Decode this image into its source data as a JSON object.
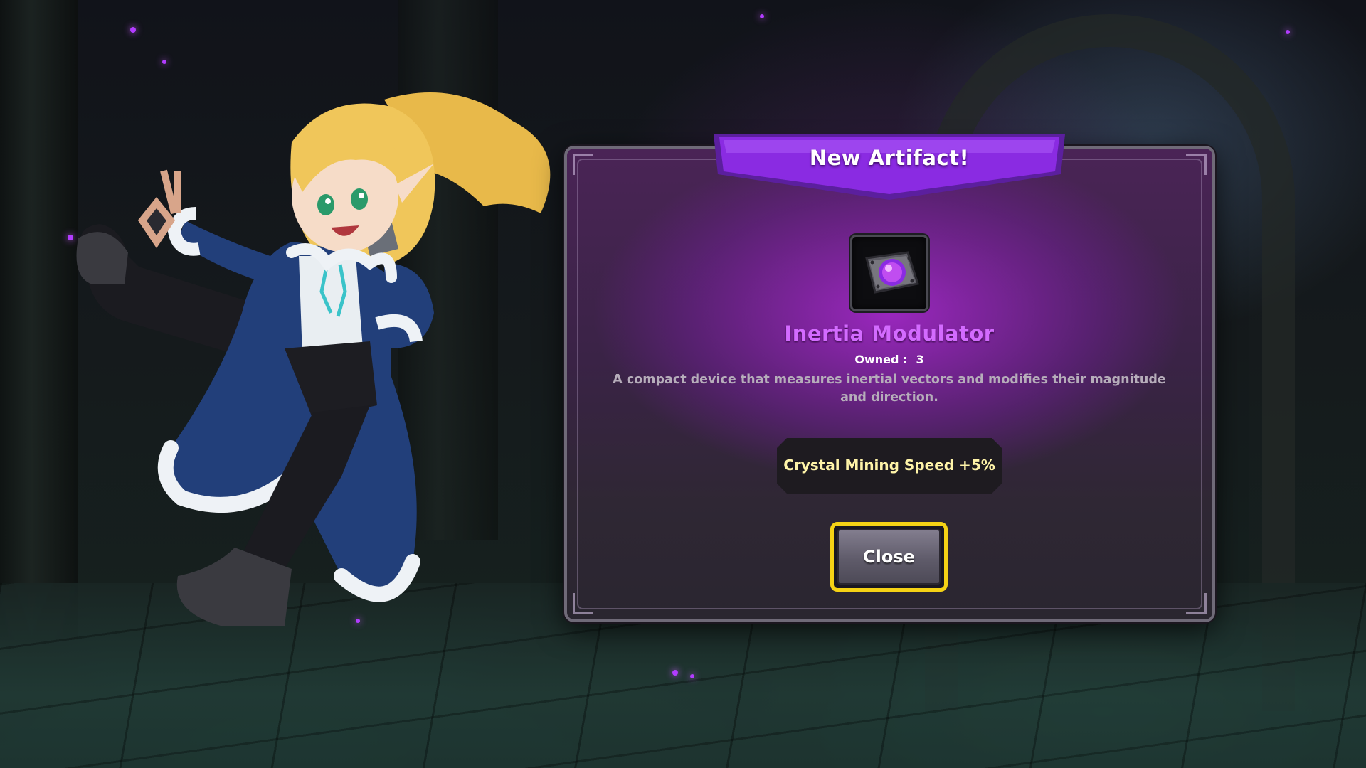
{
  "dialog": {
    "banner_title": "New Artifact!",
    "item_name": "Inertia Modulator",
    "owned_label": "Owned :",
    "owned_count": "3",
    "description": "A compact device that measures inertial vectors and modifies their magnitude and direction.",
    "stat_bonus": "Crystal Mining Speed +5%",
    "close_label": "Close",
    "item_icon": "purple-gem-icon"
  },
  "colors": {
    "banner": "#8a2be2",
    "item_name": "#d36bff",
    "stat_text": "#fff4a8",
    "button_border": "#f5d215"
  }
}
